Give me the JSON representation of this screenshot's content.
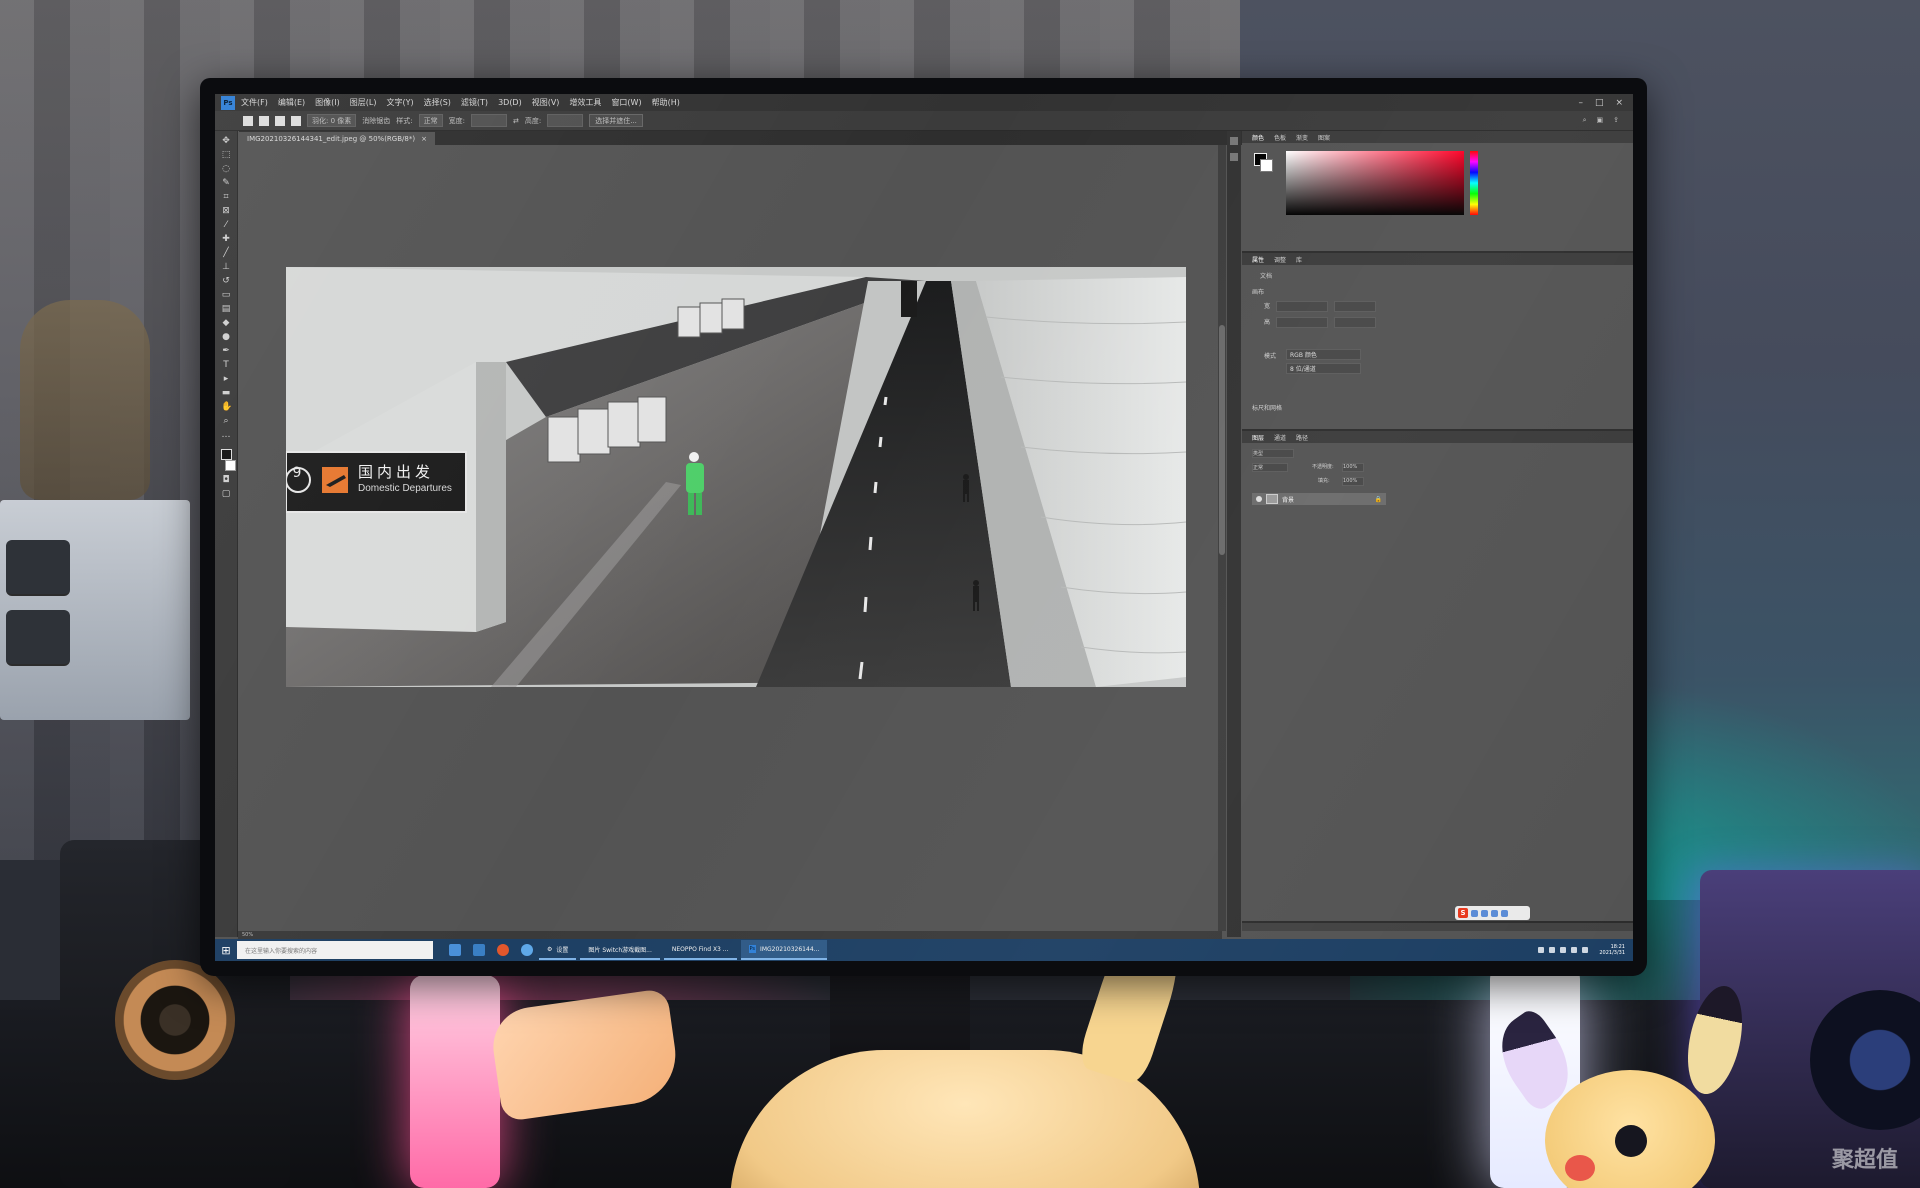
{
  "photoshop": {
    "logo_text": "Ps",
    "menu_items": [
      "文件(F)",
      "编辑(E)",
      "图像(I)",
      "图层(L)",
      "文字(Y)",
      "选择(S)",
      "滤镜(T)",
      "3D(D)",
      "视图(V)",
      "增效工具",
      "窗口(W)",
      "帮助(H)"
    ],
    "document_tab": "IMG20210326144341_edit.jpeg @ 50%(RGB/8*)",
    "status_text": "50%",
    "options": {
      "feather_label": "羽化: 0 像素",
      "antialias_label": "消除锯齿",
      "style_label": "样式:",
      "style_value": "正常",
      "width_label": "宽度:",
      "height_label": "高度:",
      "select_mask_button": "选择并遮住..."
    }
  },
  "photo": {
    "sign_number": "9",
    "sign_chinese": "国内出发",
    "sign_english": "Domestic Departures"
  },
  "panels": {
    "color_tabs": [
      "颜色",
      "色板",
      "渐变",
      "图案"
    ],
    "props_tabs": [
      "属性",
      "调整",
      "库"
    ],
    "props_doc_label": "文档",
    "props_section": "画布",
    "props_w_label": "宽",
    "props_h_label": "高",
    "props_mode_label": "模式",
    "props_mode_value": "RGB 颜色",
    "props_depth_value": "8 位/通道",
    "props_guide_section": "标尺和网格",
    "layers_tabs": [
      "图层",
      "通道",
      "路径"
    ],
    "layers_search": "类型",
    "layers_mode": "正常",
    "layers_opacity_label": "不透明度:",
    "layers_opacity_value": "100%",
    "layers_fill_label": "填充:",
    "layers_fill_value": "100%",
    "layer_name": "背景"
  },
  "taskbar": {
    "start_icon": "windows-icon",
    "search_placeholder": "在这里输入你要搜索的内容",
    "apps": [
      {
        "label": "设置",
        "active": false
      },
      {
        "label": "图片 Switch游戏截图...",
        "active": false
      },
      {
        "label": "NEOPPO Find X3 ...",
        "active": false
      },
      {
        "label": "IMG20210326144...",
        "active": true
      }
    ],
    "time": "18:21",
    "date": "2021/3/31"
  },
  "watermark": "聚超值"
}
